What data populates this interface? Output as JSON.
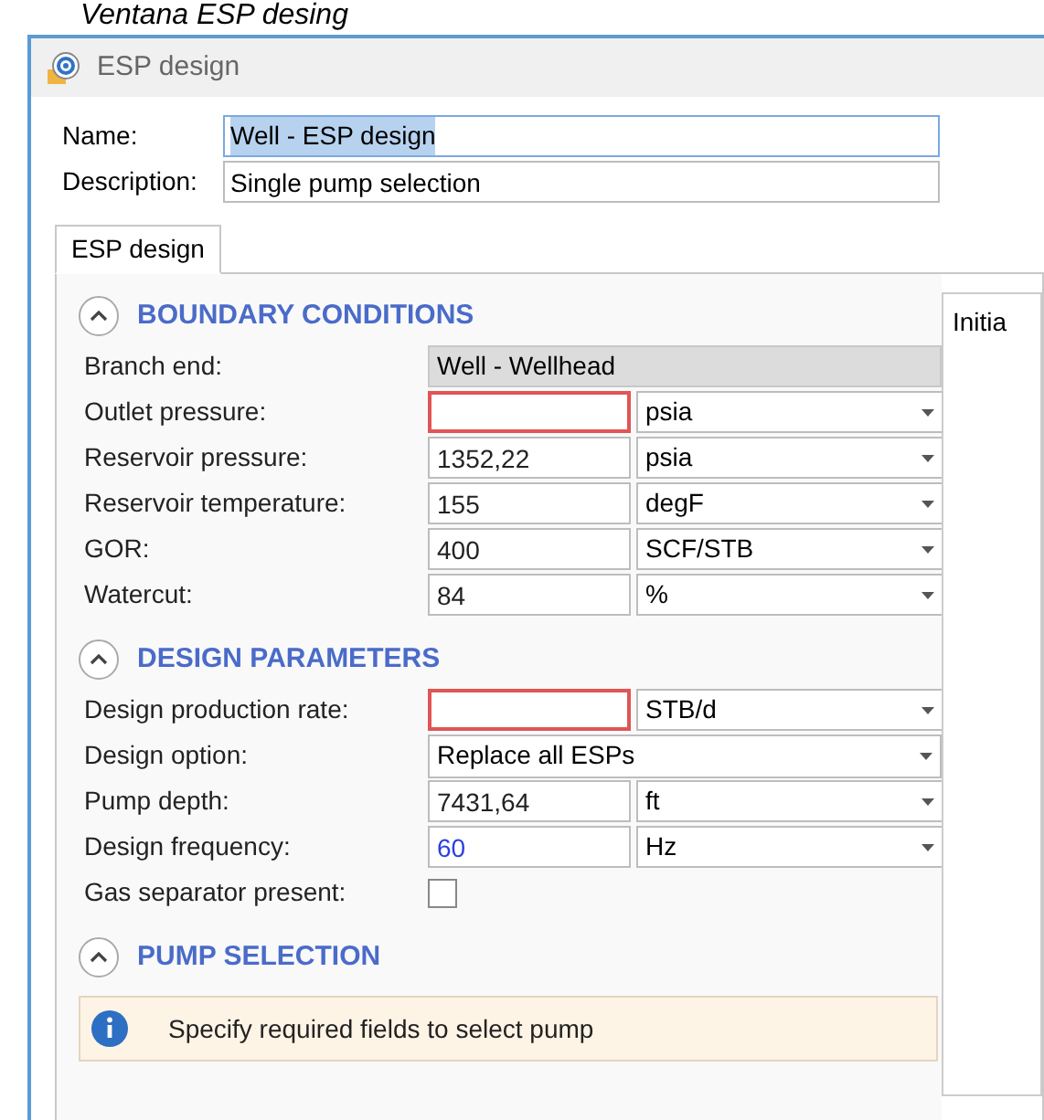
{
  "caption": "Ventana ESP desing",
  "window": {
    "title": "ESP design"
  },
  "name": {
    "label": "Name:",
    "value": "Well - ESP design",
    "selected": true
  },
  "description": {
    "label": "Description:",
    "value": "Single pump selection"
  },
  "tabs": [
    {
      "label": "ESP design",
      "selected": true
    }
  ],
  "side_panel": {
    "title": "Initia"
  },
  "sections": [
    {
      "title": "BOUNDARY CONDITIONS",
      "expanded": true,
      "rows": [
        {
          "kind": "readonly",
          "label": "Branch end:",
          "value": "Well - Wellhead"
        },
        {
          "kind": "unit",
          "label": "Outlet pressure:",
          "value": "",
          "invalid": true,
          "default": false,
          "unit": "psia"
        },
        {
          "kind": "unit",
          "label": "Reservoir pressure:",
          "value": "1352,22",
          "invalid": false,
          "default": false,
          "unit": "psia"
        },
        {
          "kind": "unit",
          "label": "Reservoir temperature:",
          "value": "155",
          "invalid": false,
          "default": false,
          "unit": "degF"
        },
        {
          "kind": "unit",
          "label": "GOR:",
          "value": "400",
          "invalid": false,
          "default": false,
          "unit": "SCF/STB"
        },
        {
          "kind": "unit",
          "label": "Watercut:",
          "value": "84",
          "invalid": false,
          "default": false,
          "unit": "%"
        }
      ]
    },
    {
      "title": "DESIGN PARAMETERS",
      "expanded": true,
      "rows": [
        {
          "kind": "unit",
          "label": "Design production rate:",
          "value": "",
          "invalid": true,
          "default": false,
          "unit": "STB/d"
        },
        {
          "kind": "select",
          "label": "Design option:",
          "value": "Replace all ESPs"
        },
        {
          "kind": "unit",
          "label": "Pump depth:",
          "value": "7431,64",
          "invalid": false,
          "default": false,
          "unit": "ft"
        },
        {
          "kind": "unit",
          "label": "Design frequency:",
          "value": "60",
          "invalid": false,
          "default": true,
          "unit": "Hz"
        },
        {
          "kind": "checkbox",
          "label": "Gas separator present:",
          "checked": false
        }
      ]
    },
    {
      "title": "PUMP SELECTION",
      "expanded": true,
      "message": "Specify required fields to select pump"
    }
  ]
}
